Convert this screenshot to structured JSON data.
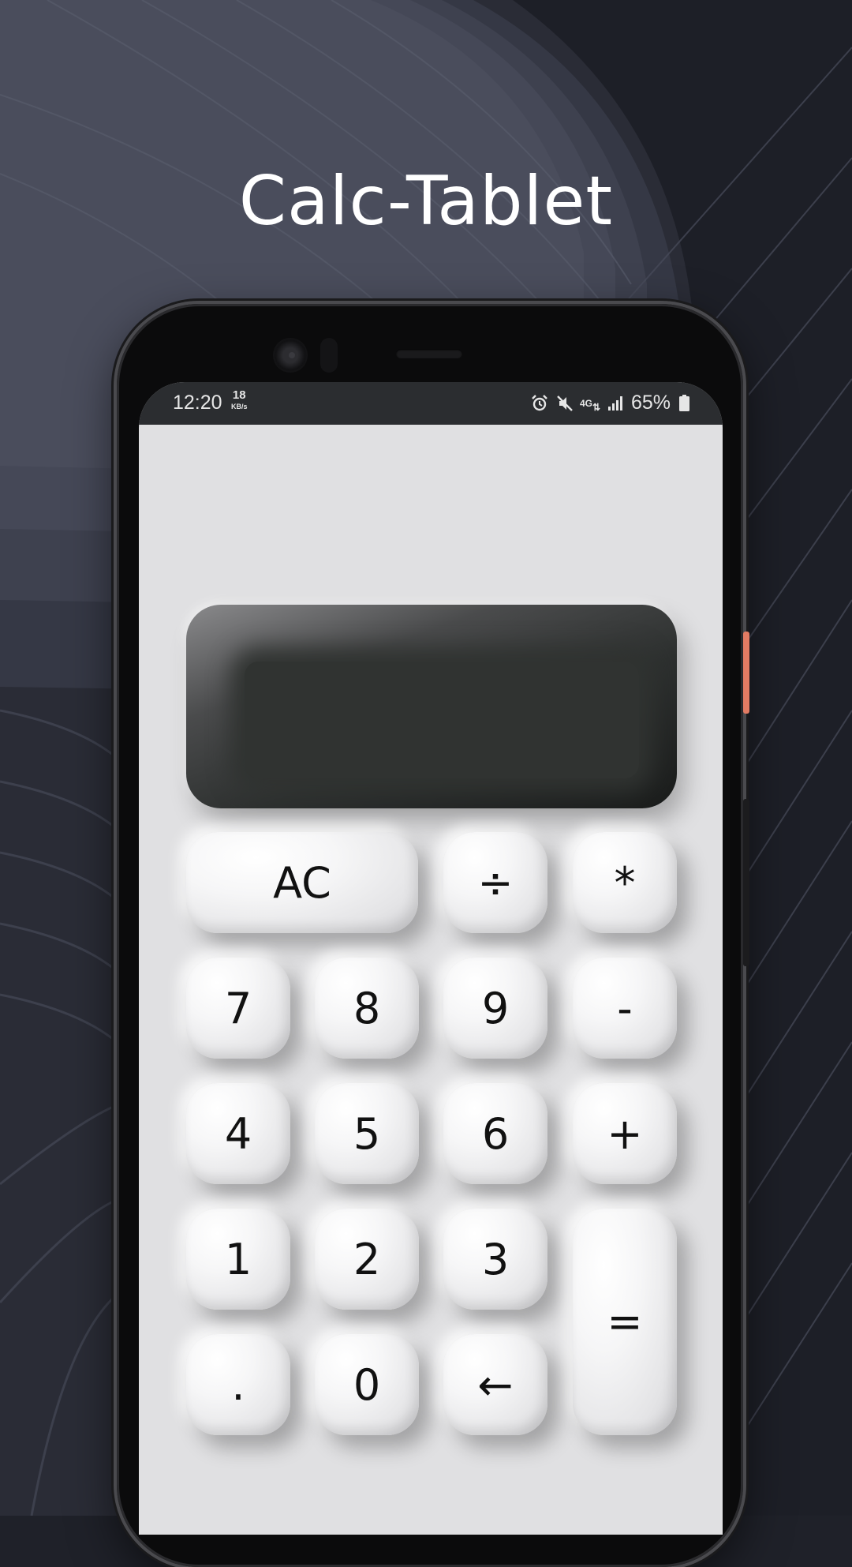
{
  "headline": "Calc-Tablet",
  "status_bar": {
    "time": "12:20",
    "net_speed_value": "18",
    "net_speed_unit": "KB/s",
    "network_type": "4G",
    "battery_percent": "65%",
    "icons": [
      "alarm-icon",
      "mute-icon",
      "4g-data-icon",
      "signal-icon",
      "battery-icon"
    ]
  },
  "display": {
    "value": ""
  },
  "keys": {
    "clear": "AC",
    "divide": "÷",
    "multiply": "*",
    "seven": "7",
    "eight": "8",
    "nine": "9",
    "minus": "-",
    "four": "4",
    "five": "5",
    "six": "6",
    "plus": "+",
    "one": "1",
    "two": "2",
    "three": "3",
    "equals": "=",
    "decimal": ".",
    "zero": "0",
    "backspace": "←"
  },
  "colors": {
    "background": "#1f2129",
    "screen": "#e0e0e2",
    "status_bar": "#2b2d30",
    "display": "#303331",
    "accent_side_button": "#e27b63"
  }
}
